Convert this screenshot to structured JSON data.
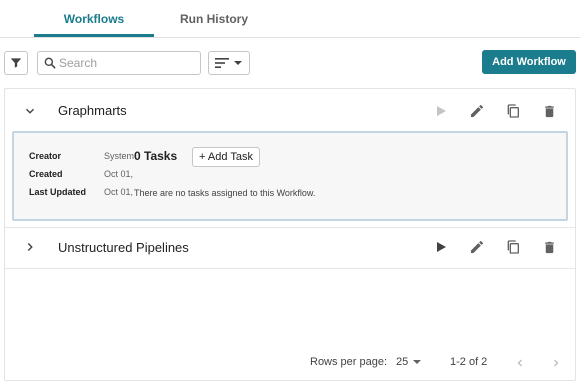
{
  "tabs": [
    {
      "label": "Workflows",
      "active": true
    },
    {
      "label": "Run History",
      "active": false
    }
  ],
  "toolbar": {
    "search_placeholder": "Search",
    "add_workflow_label": "Add Workflow"
  },
  "workflows": [
    {
      "name": "Graphmarts",
      "expanded": true,
      "run_enabled": false,
      "details": {
        "creator_label": "Creator",
        "creator_value": "System",
        "created_label": "Created",
        "created_value": "Oct 01,",
        "updated_label": "Last Updated",
        "updated_value": "Oct 01,"
      },
      "tasks_title": "0 Tasks",
      "add_task_label": "+ Add Task",
      "empty_message": "There are no tasks assigned to this Workflow."
    },
    {
      "name": "Unstructured Pipelines",
      "expanded": false,
      "run_enabled": true
    }
  ],
  "pagination": {
    "rows_per_page_label": "Rows per page:",
    "rows_per_page_value": "25",
    "range_text": "1-2 of 2"
  },
  "colors": {
    "accent": "#1a7c8c",
    "panel_border": "#c3d4e3"
  }
}
